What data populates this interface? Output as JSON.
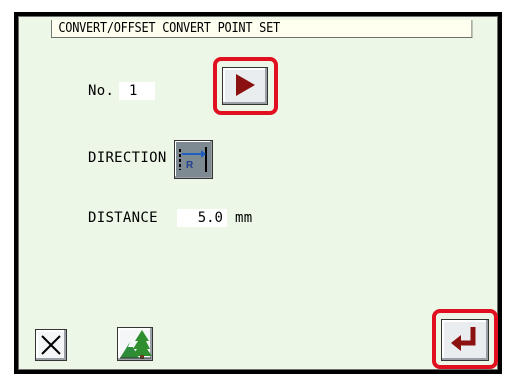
{
  "title": "CONVERT/OFFSET CONVERT POINT SET",
  "number": {
    "label": "No.",
    "value": "1"
  },
  "direction": {
    "label": "DIRECTION",
    "icon_letter": "R"
  },
  "distance": {
    "label": "DISTANCE",
    "value": "5.0",
    "unit": "mm"
  },
  "icons": {
    "next": "play-triangle-icon",
    "cancel": "cancel-x-icon",
    "tree": "tree-mountain-icon",
    "enter": "enter-return-icon",
    "direction": "direction-arrow-icon"
  },
  "colors": {
    "panel_bg": "#ecf7e7",
    "highlight_red": "#e01020",
    "arrow_dark_red": "#8b1010"
  }
}
